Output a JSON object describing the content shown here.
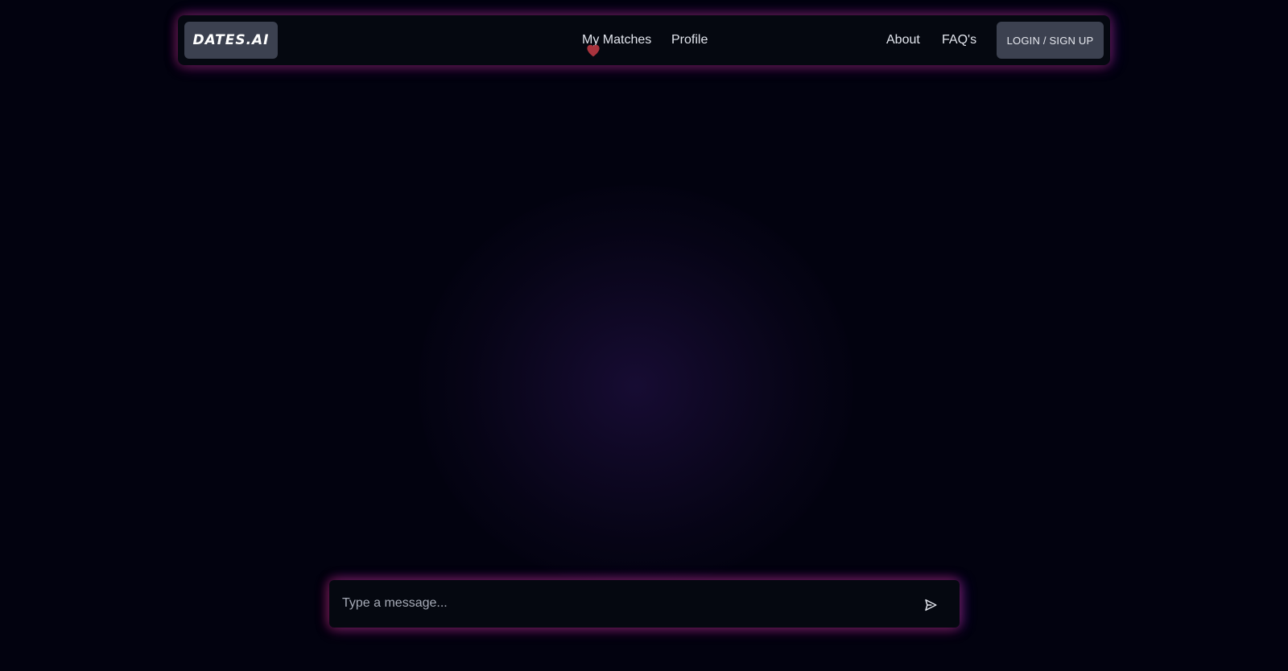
{
  "brand": {
    "logo_text": "DATES.AI"
  },
  "nav": {
    "links": [
      {
        "label": "My Matches"
      },
      {
        "label": "Profile"
      },
      {
        "label": "About"
      },
      {
        "label": "FAQ's"
      }
    ],
    "login_label": "LOGIN / SIGN UP",
    "active_indicator_icon": "heart-icon"
  },
  "chat": {
    "placeholder": "Type a message...",
    "send_icon": "send-icon"
  },
  "colors": {
    "background": "#02020f",
    "navbar_bg": "#050810",
    "button_bg": "#3c4150",
    "heart": "#a8333d",
    "glow_pink": "#8c1e5a",
    "glow_blue": "#4628c8"
  }
}
